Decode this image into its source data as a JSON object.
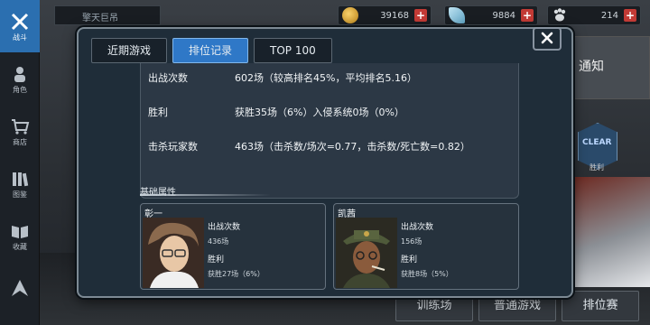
{
  "nav": [
    {
      "label": "战斗",
      "icon": "crossed-swords-icon",
      "active": true
    },
    {
      "label": "角色",
      "icon": "character-icon",
      "active": false
    },
    {
      "label": "商店",
      "icon": "cart-icon",
      "active": false
    },
    {
      "label": "图鉴",
      "icon": "books-icon",
      "active": false
    },
    {
      "label": "收藏",
      "icon": "open-book-icon",
      "active": false
    },
    {
      "label": "",
      "icon": "rank-icon",
      "active": false
    }
  ],
  "top_bar": {
    "title": "擎天巨吊",
    "currencies": [
      {
        "icon": "gold-coin-icon",
        "value": "39168"
      },
      {
        "icon": "feather-icon",
        "value": "9884"
      },
      {
        "icon": "paw-icon",
        "value": "214"
      }
    ]
  },
  "background": {
    "notice_label": "通知",
    "clear_badge": "CLEAR",
    "clear_caption": "胜利",
    "bottom_buttons": [
      "训练场",
      "普通游戏",
      "排位赛"
    ]
  },
  "modal": {
    "tabs": [
      {
        "label": "近期游戏",
        "active": false
      },
      {
        "label": "排位记录",
        "active": true
      },
      {
        "label": "TOP 100",
        "active": false
      }
    ],
    "stats": [
      {
        "label": "出战次数",
        "value": "602场（较高排名45%，平均排名5.16）"
      },
      {
        "label": "胜利",
        "value": "获胜35场（6%）入侵系统0场（0%）"
      },
      {
        "label": "击杀玩家数",
        "value": "463场（击杀数/场次=0.77，击杀数/死亡数=0.82）"
      }
    ],
    "section_title": "基础属性",
    "characters": [
      {
        "name": "彰一",
        "games_label": "出战次数",
        "games_value": "436场",
        "wins_label": "胜利",
        "wins_value": "获胜27场（6%）"
      },
      {
        "name": "凯茜",
        "games_label": "出战次数",
        "games_value": "156场",
        "wins_label": "胜利",
        "wins_value": "获胜8场（5%）"
      }
    ]
  }
}
